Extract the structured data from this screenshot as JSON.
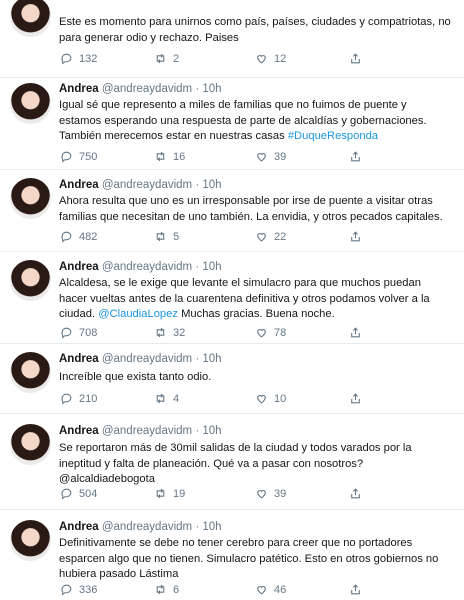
{
  "tweets": [
    {
      "name": "",
      "handle": "",
      "time": "",
      "text_parts": [
        {
          "t": "Este es momento para unirnos como país, países, ciudades y compatriotas, no para generar odio y rechazo. Paises",
          "link": false
        }
      ],
      "stats": {
        "replies": "132",
        "retweets": "2",
        "likes": "12"
      }
    },
    {
      "name": "Andrea",
      "handle": "@andreaydavidm",
      "time": "10h",
      "text_parts": [
        {
          "t": "Igual sé que represento a miles de familias que no fuimos de puente y estamos esperando una respuesta de parte de alcaldías y gobernaciones. También merecemos estar en nuestras casas ",
          "link": false
        },
        {
          "t": "#DuqueResponda",
          "link": true
        }
      ],
      "stats": {
        "replies": "750",
        "retweets": "16",
        "likes": "39"
      }
    },
    {
      "name": "Andrea",
      "handle": "@andreaydavidm",
      "time": "10h",
      "text_parts": [
        {
          "t": "Ahora resulta que uno es un irresponsable por irse de puente a visitar otras familias que necesitan de uno también. La envidia, y otros pecados capitales.",
          "link": false
        }
      ],
      "stats": {
        "replies": "482",
        "retweets": "5",
        "likes": "22"
      }
    },
    {
      "name": "Andrea",
      "handle": "@andreaydavidm",
      "time": "10h",
      "text_parts": [
        {
          "t": "Alcaldesa, se le exige que levante el simulacro para que muchos puedan hacer vueltas antes de la cuarentena definitiva y otros podamos volver a la ciudad. ",
          "link": false
        },
        {
          "t": "@ClaudiaLopez",
          "link": true
        },
        {
          "t": " Muchas gracias. Buena noche.",
          "link": false
        }
      ],
      "stats": {
        "replies": "708",
        "retweets": "32",
        "likes": "78"
      }
    },
    {
      "name": "Andrea",
      "handle": "@andreaydavidm",
      "time": "10h",
      "text_parts": [
        {
          "t": "Increíble que exista tanto odio.",
          "link": false
        }
      ],
      "stats": {
        "replies": "210",
        "retweets": "4",
        "likes": "10"
      }
    },
    {
      "name": "Andrea",
      "handle": "@andreaydavidm",
      "time": "10h",
      "text_parts": [
        {
          "t": "Se reportaron más de 30mil salidas de la ciudad y todos varados por la ineptitud y falta de planeación. Qué va a pasar con nosotros? @alcaldiadebogota",
          "link": false
        }
      ],
      "stats": {
        "replies": "504",
        "retweets": "19",
        "likes": "39"
      }
    },
    {
      "name": "Andrea",
      "handle": "@andreaydavidm",
      "time": "10h",
      "text_parts": [
        {
          "t": "Definitivamente se debe no tener cerebro para creer que no portadores esparcen algo que no tienen. Simulacro patético. Esto en otros gobiernos no hubiera pasado Lástima",
          "link": false
        }
      ],
      "stats": {
        "replies": "336",
        "retweets": "6",
        "likes": "46"
      }
    }
  ],
  "icons": {
    "reply": "reply-icon",
    "retweet": "retweet-icon",
    "like": "like-icon",
    "share": "share-icon"
  },
  "colors": {
    "link": "#1b95e0",
    "muted": "#657786",
    "divider": "#e6ecf0"
  }
}
